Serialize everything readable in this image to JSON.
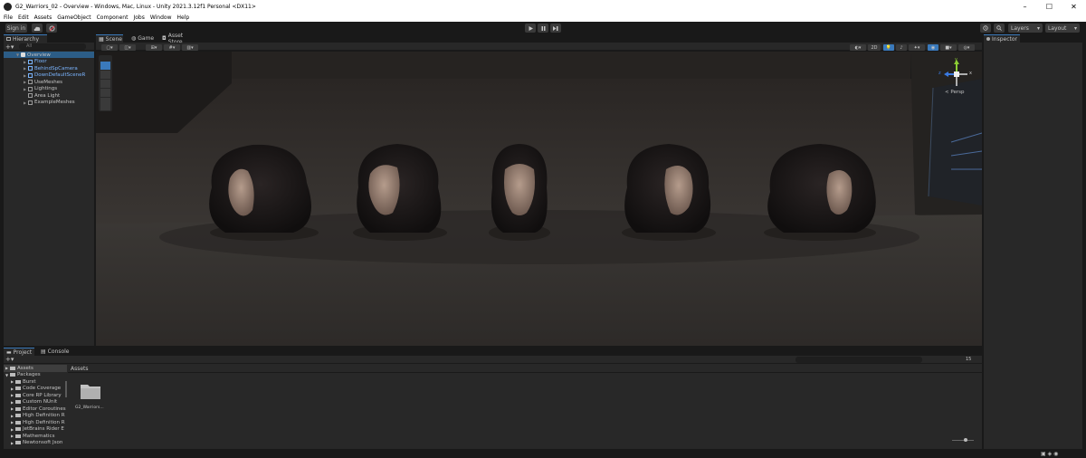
{
  "window": {
    "title": "G2_Warriors_02 - Overview - Windows, Mac, Linux - Unity 2021.3.12f1 Personal <DX11>",
    "minimize": "–",
    "maximize": "☐",
    "close": "✕"
  },
  "menu": [
    "File",
    "Edit",
    "Assets",
    "GameObject",
    "Component",
    "Jobs",
    "Window",
    "Help"
  ],
  "toolbar": {
    "sign_in": "Sign in",
    "play_icon": "play-icon",
    "layers": "Layers",
    "layout": "Layout"
  },
  "hierarchy": {
    "tab": "Hierarchy",
    "search_placeholder": "All",
    "scene": "Overview",
    "items": [
      {
        "label": "Floor",
        "blue": true
      },
      {
        "label": "BehindSpCamera",
        "blue": true
      },
      {
        "label": "DownDefaultSceneR",
        "blue": true
      },
      {
        "label": "UseMeshes",
        "blue": false
      },
      {
        "label": "Lightings",
        "blue": false
      },
      {
        "label": "Area Light",
        "blue": false
      },
      {
        "label": "ExampleMeshes",
        "blue": false
      }
    ]
  },
  "scene": {
    "tabs": [
      "Scene",
      "Game",
      "Asset Store"
    ],
    "mode_2d": "2D",
    "persp": "< Persp",
    "axis_x": "x",
    "axis_y": "y",
    "axis_z": "z"
  },
  "inspector": {
    "tab": "Inspector"
  },
  "project": {
    "tabs": [
      "Project",
      "Console"
    ],
    "assets_root": "Assets",
    "packages_root": "Packages",
    "breadcrumb": "Assets",
    "packages": [
      "Burst",
      "Code Coverage",
      "Core RP Library",
      "Custom NUnit",
      "Editor Coroutines",
      "High Definition R",
      "High Definition R",
      "JetBrains Rider E",
      "Mathematics",
      "Newtonsoft Json"
    ],
    "folder_label": "G2_Warriors...",
    "count": "15"
  }
}
